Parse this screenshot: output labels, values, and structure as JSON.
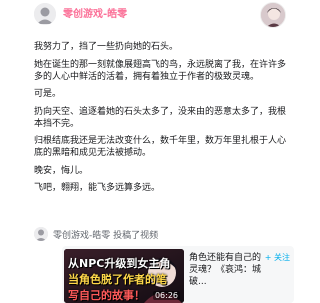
{
  "post": {
    "author": "零创游戏-皓零"
  },
  "content": {
    "paragraphs": [
      "我努力了，挡了一些扔向她的石头。",
      "她在诞生的那一刻就像展翅高飞的鸟，永远脱离了我，在许许多多的人心中鲜活的活着，拥有着独立于作者的极致灵魂。",
      "可是。",
      "扔向天空、追逐着她的石头太多了，没来由的恶意太多了，我根本挡不完。",
      "归根结底我还是无法改变什么，数千年里，数万年里扎根于人心底的黑暗和成见无法被撼动。",
      "晚安，悔儿。",
      "飞吧，翱翔，能飞多远算多远。"
    ]
  },
  "share": {
    "author": "零创游戏-皓零",
    "action": "投稿了视频"
  },
  "video_card": {
    "thumbnail_lines": [
      "从NPC升级到女主角",
      "当角色脱了作者的笔",
      "写自己的故事！"
    ],
    "duration": "06:26",
    "title": "角色还能有自己的灵魂？《哀鸿：城破...",
    "follow_label": "+ 关注"
  },
  "colors": {
    "brand_pink": "#fb7299",
    "link_blue": "#00aeec"
  }
}
